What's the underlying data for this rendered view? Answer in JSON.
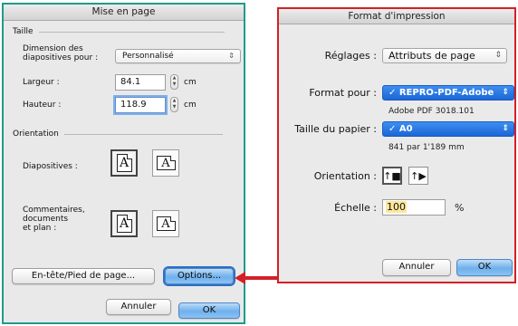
{
  "left_dialog": {
    "title": "Mise en page",
    "size_section": "Taille",
    "slide_dimension_label": "Dimension des\ndiapositives pour :",
    "slide_dimension_value": "Personnalisé",
    "width_label": "Largeur :",
    "width_value": "84.1",
    "height_label": "Hauteur :",
    "height_value": "118.9",
    "unit": "cm",
    "orientation_section": "Orientation",
    "slides_label": "Diapositives :",
    "notes_label": "Commentaires,\ndocuments\net plan :",
    "glyph": "A",
    "header_footer_button": "En-tête/Pied de page...",
    "options_button": "Options...",
    "cancel_button": "Annuler",
    "ok_button": "OK"
  },
  "right_dialog": {
    "title": "Format d'impression",
    "settings_label": "Réglages :",
    "settings_value": "Attributs de page",
    "format_for_label": "Format pour :",
    "format_for_value": "✓ REPRO-PDF-Adobe",
    "format_for_sub": "Adobe PDF 3018.101",
    "paper_size_label": "Taille du papier :",
    "paper_size_value": "✓ A0",
    "paper_size_sub": "841 par 1'189 mm",
    "orientation_label": "Orientation :",
    "scale_label": "Échelle :",
    "scale_value": "100",
    "scale_unit": "%",
    "cancel_button": "Annuler",
    "ok_button": "OK"
  },
  "colors": {
    "left_frame": "#1f9a8f",
    "right_frame": "#d32027",
    "arrow": "#d32027",
    "default_button": "#6fb0ec",
    "selected_popup": "#1b66d6"
  },
  "icons": {
    "popup_arrows": "updown-arrows-icon",
    "stepper": "stepper-icon",
    "portrait": "portrait-page-icon",
    "landscape": "landscape-page-icon"
  }
}
